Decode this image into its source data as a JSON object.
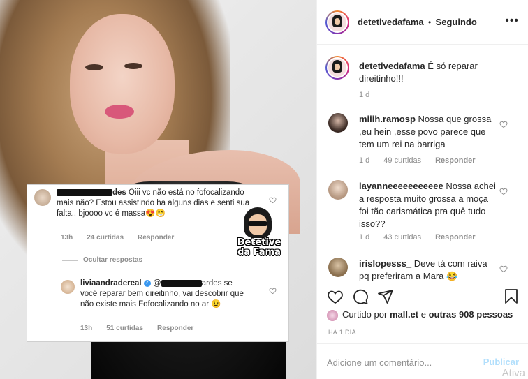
{
  "post": {
    "overlay": {
      "comment1": {
        "username_suffix": "des",
        "text": "Oiii vc não está no fofocalizando mais não? Estou assistindo ha alguns dias e senti sua falta.. bjoooo vc é massa😍😁",
        "time": "13h",
        "likes": "24 curtidas",
        "reply": "Responder"
      },
      "hide_replies": "Ocultar respostas",
      "comment2": {
        "username": "liviaandradereal",
        "mention_prefix": "@",
        "mention_suffix": "ardes",
        "text": "se você reparar bem direitinho, vai descobrir que não existe mais Fofocalizando no ar 😉",
        "time": "13h",
        "likes": "51 curtidas",
        "reply": "Responder"
      },
      "logo_text": "Detetive da Fama"
    }
  },
  "panel": {
    "header": {
      "username": "detetivedafama",
      "separator": "•",
      "follow_status": "Seguindo",
      "more": "•••"
    },
    "caption": {
      "username": "detetivedafama",
      "text": "É só reparar direitinho!!!",
      "time": "1 d"
    },
    "comments": [
      {
        "username": "miiih.ramosp",
        "text": "Nossa que grossa ,eu hein ,esse povo parece que tem um rei na barriga",
        "time": "1 d",
        "likes": "49 curtidas",
        "reply": "Responder",
        "avatar_color": "#3a2a24"
      },
      {
        "username": "layanneeeeeeeeeee",
        "text": "Nossa achei a resposta muito grossa a moça foi tão carismática pra quê tudo isso??",
        "time": "1 d",
        "likes": "43 curtidas",
        "reply": "Responder",
        "avatar_color": "#b59780"
      },
      {
        "username": "irislopesss_",
        "text": "Deve tá com raiva pq preferiram a Mara 😂",
        "time": "",
        "likes": "",
        "reply": "",
        "avatar_color": "#8a6f4e"
      }
    ],
    "likes": {
      "prefix": "Curtido por",
      "user": "mall.et",
      "connector": "e",
      "others": "outras 908 pessoas"
    },
    "timestamp": "HÁ 1 DIA",
    "add_comment": {
      "placeholder": "Adicione um comentário...",
      "post_label": "Publicar"
    },
    "watermark": "Ativa"
  },
  "icons": {
    "heart": "heart-icon",
    "comment": "comment-icon",
    "share": "share-icon",
    "save": "bookmark-icon",
    "more": "more-options-icon"
  }
}
